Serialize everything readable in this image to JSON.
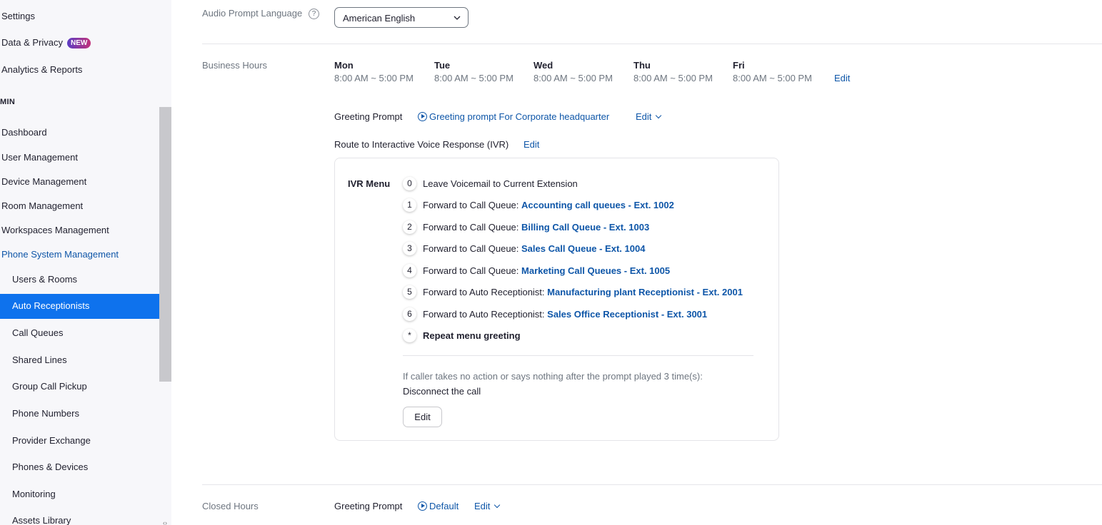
{
  "sidebar": {
    "items_top": [
      {
        "label": "Settings"
      },
      {
        "label": "Data & Privacy",
        "badge": "NEW"
      },
      {
        "label": "Analytics & Reports"
      }
    ],
    "section": "MIN",
    "admin_items": [
      {
        "label": "Dashboard"
      },
      {
        "label": "User Management"
      },
      {
        "label": "Device Management"
      },
      {
        "label": "Room Management"
      },
      {
        "label": "Workspaces Management"
      },
      {
        "label": "Phone System Management"
      }
    ],
    "sub_items": [
      {
        "label": "Users & Rooms"
      },
      {
        "label": "Auto Receptionists"
      },
      {
        "label": "Call Queues"
      },
      {
        "label": "Shared Lines"
      },
      {
        "label": "Group Call Pickup"
      },
      {
        "label": "Phone Numbers"
      },
      {
        "label": "Provider Exchange"
      },
      {
        "label": "Phones & Devices"
      },
      {
        "label": "Monitoring"
      },
      {
        "label": "Assets Library"
      }
    ]
  },
  "audio_prompt": {
    "label": "Audio Prompt Language",
    "help": "?",
    "value": "American English"
  },
  "business_hours": {
    "label": "Business Hours",
    "days": [
      {
        "name": "Mon",
        "hours": "8:00 AM ~ 5:00 PM"
      },
      {
        "name": "Tue",
        "hours": "8:00 AM ~ 5:00 PM"
      },
      {
        "name": "Wed",
        "hours": "8:00 AM ~ 5:00 PM"
      },
      {
        "name": "Thu",
        "hours": "8:00 AM ~ 5:00 PM"
      },
      {
        "name": "Fri",
        "hours": "8:00 AM ~ 5:00 PM"
      }
    ],
    "edit": "Edit",
    "greeting_label": "Greeting Prompt",
    "greeting_value": "Greeting prompt For Corporate headquarter",
    "greeting_edit": "Edit",
    "route_label": "Route to Interactive Voice Response (IVR)",
    "route_edit": "Edit"
  },
  "ivr": {
    "title": "IVR Menu",
    "rows": [
      {
        "key": "0",
        "text": "Leave Voicemail to Current Extension",
        "target": ""
      },
      {
        "key": "1",
        "text": "Forward to Call Queue: ",
        "target": "Accounting call queues - Ext. 1002"
      },
      {
        "key": "2",
        "text": "Forward to Call Queue: ",
        "target": "Billing Call Queue - Ext. 1003"
      },
      {
        "key": "3",
        "text": "Forward to Call Queue: ",
        "target": "Sales Call Queue - Ext. 1004"
      },
      {
        "key": "4",
        "text": "Forward to Call Queue: ",
        "target": "Marketing Call Queues - Ext. 1005"
      },
      {
        "key": "5",
        "text": "Forward to Auto Receptionist: ",
        "target": "Manufacturing plant Receptionist - Ext. 2001"
      },
      {
        "key": "6",
        "text": "Forward to Auto Receptionist: ",
        "target": "Sales Office Receptionist - Ext. 3001"
      },
      {
        "key": "*",
        "text": "Repeat menu greeting",
        "target": ""
      }
    ],
    "no_action_note": "If caller takes no action or says nothing after the prompt played 3 time(s):",
    "no_action_result": "Disconnect the call",
    "edit_button": "Edit"
  },
  "closed_hours": {
    "label": "Closed Hours",
    "greeting_label": "Greeting Prompt",
    "greeting_value": "Default",
    "greeting_edit": "Edit"
  },
  "colors": {
    "accent": "#0e72ed",
    "link": "#0e56a8"
  }
}
